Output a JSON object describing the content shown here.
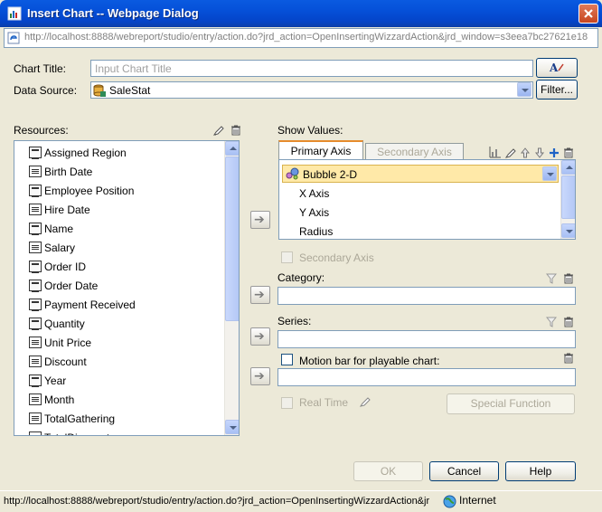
{
  "window": {
    "title": "Insert Chart -- Webpage Dialog",
    "url": "http://localhost:8888/webreport/studio/entry/action.do?jrd_action=OpenInsertingWizzardAction&jrd_window=s3eea7bc27621e18"
  },
  "form": {
    "chart_title_label": "Chart Title:",
    "chart_title_placeholder": "Input Chart Title",
    "data_source_label": "Data Source:",
    "data_source_value": "SaleStat",
    "filter_button": "Filter..."
  },
  "resources": {
    "label": "Resources:",
    "items": [
      {
        "label": "Assigned Region",
        "kind": "string"
      },
      {
        "label": "Birth Date",
        "kind": "number"
      },
      {
        "label": "Employee Position",
        "kind": "string"
      },
      {
        "label": "Hire Date",
        "kind": "number"
      },
      {
        "label": "Name",
        "kind": "string"
      },
      {
        "label": "Salary",
        "kind": "number"
      },
      {
        "label": "Order ID",
        "kind": "string"
      },
      {
        "label": "Order Date",
        "kind": "string"
      },
      {
        "label": "Payment Received",
        "kind": "string"
      },
      {
        "label": "Quantity",
        "kind": "string"
      },
      {
        "label": "Unit Price",
        "kind": "number"
      },
      {
        "label": "Discount",
        "kind": "number"
      },
      {
        "label": "Year",
        "kind": "string"
      },
      {
        "label": "Month",
        "kind": "number"
      },
      {
        "label": "TotalGathering",
        "kind": "number"
      },
      {
        "label": "TotalDiscount",
        "kind": "number"
      }
    ]
  },
  "show_values": {
    "label": "Show Values:",
    "tabs": [
      {
        "label": "Primary Axis",
        "active": true
      },
      {
        "label": "Secondary Axis",
        "active": false
      }
    ],
    "chart_type": "Bubble 2-D",
    "axes": [
      "X Axis",
      "Y Axis",
      "Radius"
    ]
  },
  "options": {
    "secondary_axis_label": "Secondary Axis",
    "category_label": "Category:",
    "series_label": "Series:",
    "motion_bar_label": "Motion bar for playable chart:",
    "real_time_label": "Real Time",
    "special_function_button": "Special Function"
  },
  "buttons": {
    "ok": "OK",
    "cancel": "Cancel",
    "help": "Help"
  },
  "statusbar": {
    "url": "http://localhost:8888/webreport/studio/entry/action.do?jrd_action=OpenInsertingWizzardAction&jr",
    "zone": "Internet"
  },
  "colors": {
    "titlebar": "#0550d8",
    "dialog_bg": "#ece9d8",
    "selected_item_bg": "#ffe9a8",
    "tab_active_accent": "#e68b2c"
  },
  "icons": [
    "insert-chart-window-icon",
    "close-icon",
    "ie-page-icon",
    "format-text-icon",
    "database-icon",
    "edit-icon",
    "delete-icon",
    "move-right-icon",
    "chart-icon",
    "add-icon",
    "move-up-icon",
    "move-down-icon",
    "filter-icon",
    "globe-icon"
  ]
}
